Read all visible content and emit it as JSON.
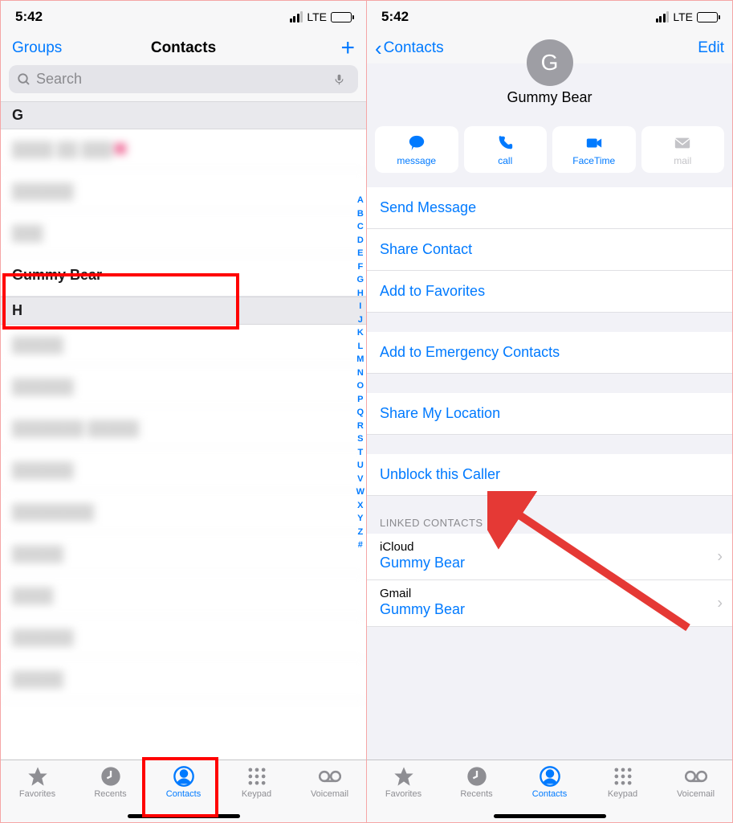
{
  "status": {
    "time": "5:42",
    "network": "LTE"
  },
  "left": {
    "groups": "Groups",
    "title": "Contacts",
    "search_placeholder": "Search",
    "sections": {
      "G": "G",
      "H": "H"
    },
    "highlighted_contact": "Gummy Bear",
    "index": [
      "A",
      "B",
      "C",
      "D",
      "E",
      "F",
      "G",
      "H",
      "I",
      "J",
      "K",
      "L",
      "M",
      "N",
      "O",
      "P",
      "Q",
      "R",
      "S",
      "T",
      "U",
      "V",
      "W",
      "X",
      "Y",
      "Z",
      "#"
    ]
  },
  "tabs": {
    "favorites": "Favorites",
    "recents": "Recents",
    "contacts": "Contacts",
    "keypad": "Keypad",
    "voicemail": "Voicemail"
  },
  "right": {
    "back": "Contacts",
    "edit": "Edit",
    "avatar_initial": "G",
    "name": "Gummy Bear",
    "actions": {
      "message": "message",
      "call": "call",
      "facetime": "FaceTime",
      "mail": "mail"
    },
    "cells": {
      "send_message": "Send Message",
      "share_contact": "Share Contact",
      "add_favorites": "Add to Favorites",
      "add_emergency": "Add to Emergency Contacts",
      "share_location": "Share My Location",
      "unblock": "Unblock this Caller"
    },
    "linked_header": "LINKED CONTACTS",
    "linked": [
      {
        "source": "iCloud",
        "name": "Gummy Bear"
      },
      {
        "source": "Gmail",
        "name": "Gummy Bear"
      }
    ]
  }
}
